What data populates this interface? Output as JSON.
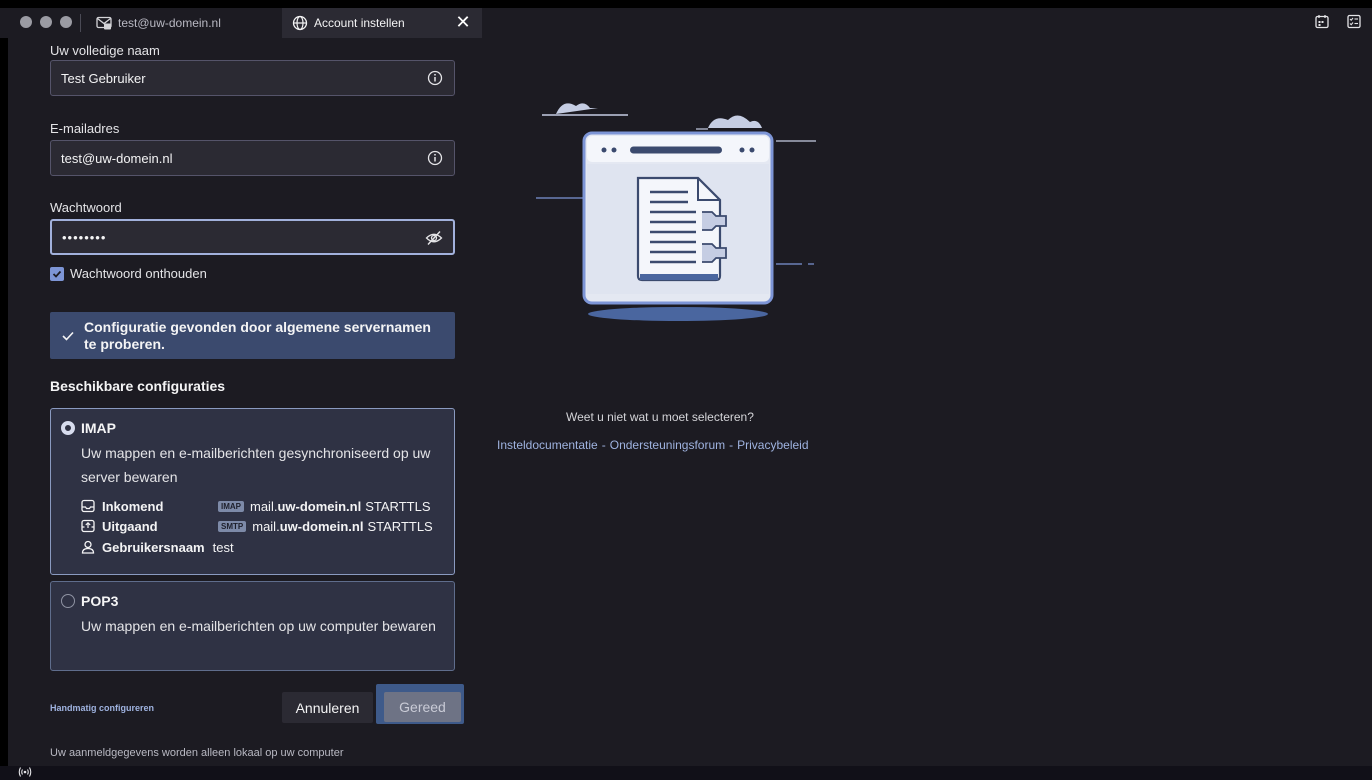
{
  "titlebar": {
    "tabs": [
      {
        "label": "test@uw-domein.nl",
        "icon": "mail-account-icon"
      },
      {
        "label": "Account instellen",
        "icon": "globe-icon",
        "close": "✕"
      }
    ],
    "right_icons": [
      "calendar-icon",
      "tasks-icon"
    ]
  },
  "form": {
    "name_label": "Uw volledige naam",
    "name_value": "Test Gebruiker",
    "email_label": "E-mailadres",
    "email_value": "test@uw-domein.nl",
    "password_label": "Wachtwoord",
    "password_value": "••••••••",
    "remember_label": "Wachtwoord onthouden",
    "remember_checked": true
  },
  "notice": {
    "text": "Configuratie gevonden door algemene servernamen te proberen."
  },
  "configs": {
    "title": "Beschikbare configuraties",
    "imap": {
      "title": "IMAP",
      "desc": "Uw mappen en e-mailberichten gesynchroniseerd op uw server bewaren",
      "selected": true,
      "incoming": {
        "label": "Inkomend",
        "badge": "IMAP",
        "host_pre": "mail.",
        "host_main": "uw-domein.nl",
        "security": "STARTTLS"
      },
      "outgoing": {
        "label": "Uitgaand",
        "badge": "SMTP",
        "host_pre": "mail.",
        "host_main": "uw-domein.nl",
        "security": "STARTTLS"
      },
      "username": {
        "label": "Gebruikersnaam",
        "value": "test"
      }
    },
    "pop3": {
      "title": "POP3",
      "desc": "Uw mappen en e-mailberichten op uw computer bewaren",
      "selected": false
    }
  },
  "actions": {
    "manual": "Handmatig configureren",
    "cancel": "Annuleren",
    "done": "Gereed"
  },
  "footnote": "Uw aanmeldgegevens worden alleen lokaal op uw computer",
  "help": {
    "question": "Weet u niet wat u moet selecteren?",
    "links": [
      "Insteldocumentatie",
      "Ondersteuningsforum",
      "Privacybeleid"
    ]
  },
  "colors": {
    "accent": "#9fb3e0",
    "background": "#1c1b22",
    "card": "#2f3244"
  }
}
